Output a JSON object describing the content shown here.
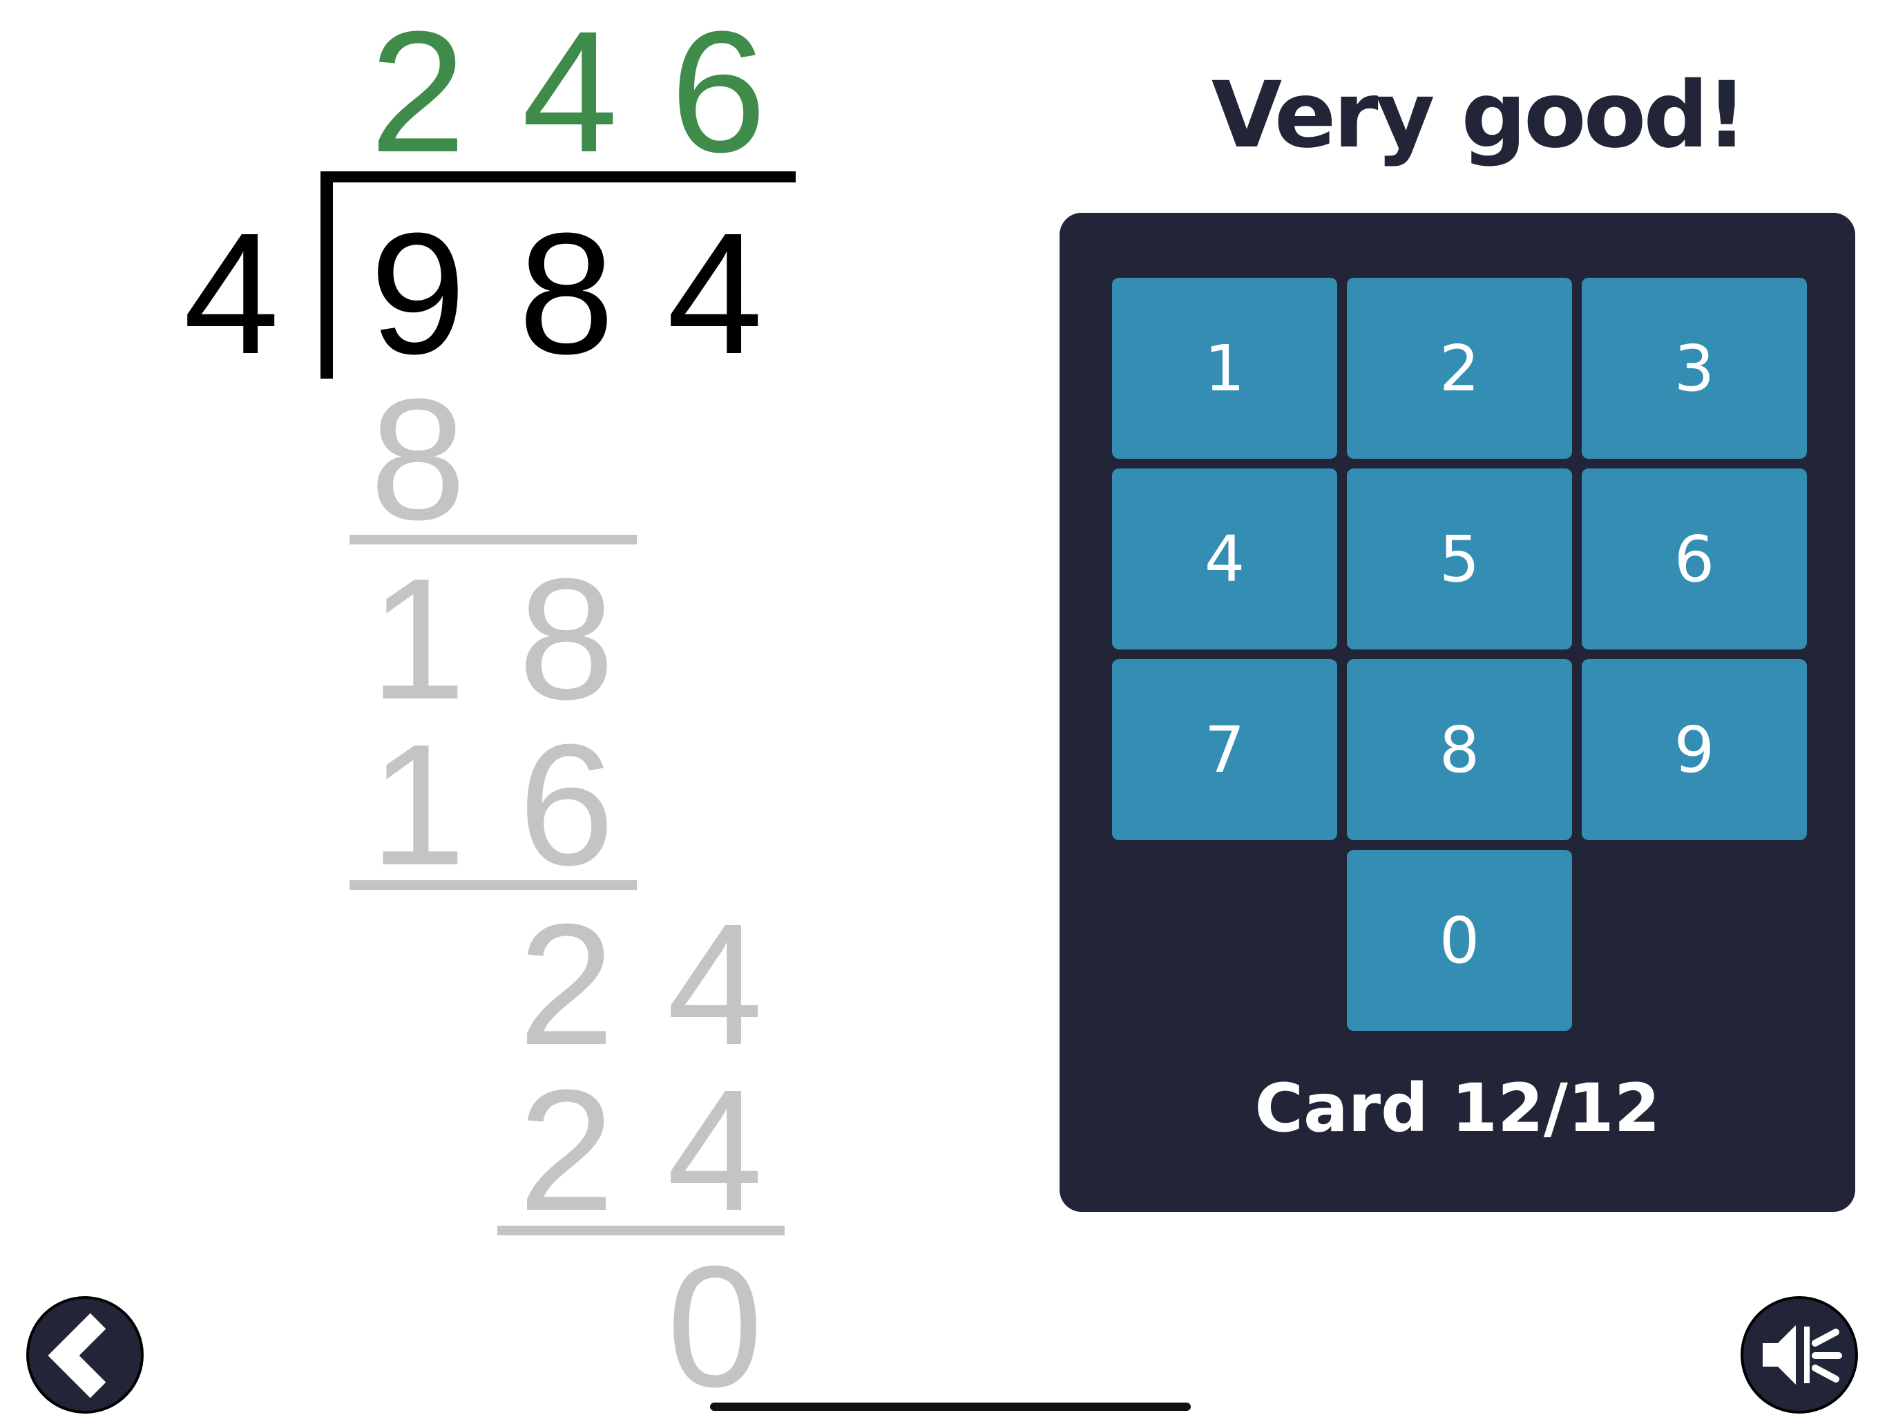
{
  "problem": {
    "quotient": [
      "2",
      "4",
      "6"
    ],
    "divisor": "4",
    "dividend": [
      "9",
      "8",
      "4"
    ]
  },
  "steps": {
    "s1": [
      "8"
    ],
    "s2": [
      "1",
      "8"
    ],
    "s3": [
      "1",
      "6"
    ],
    "s4": [
      "2",
      "4"
    ],
    "s5": [
      "2",
      "4"
    ],
    "remainder": [
      "0"
    ]
  },
  "feedback": "Very good!",
  "keypad": {
    "keys": [
      "1",
      "2",
      "3",
      "4",
      "5",
      "6",
      "7",
      "8",
      "9",
      "0"
    ]
  },
  "card_counter": "Card 12/12",
  "buttons": {
    "back": "chevron-left-icon",
    "sound": "speaker-muted-icon"
  },
  "colors": {
    "quotient": "#3f8b4a",
    "steps": "#c4c4c4",
    "panel": "#222437",
    "key": "#348db2"
  }
}
